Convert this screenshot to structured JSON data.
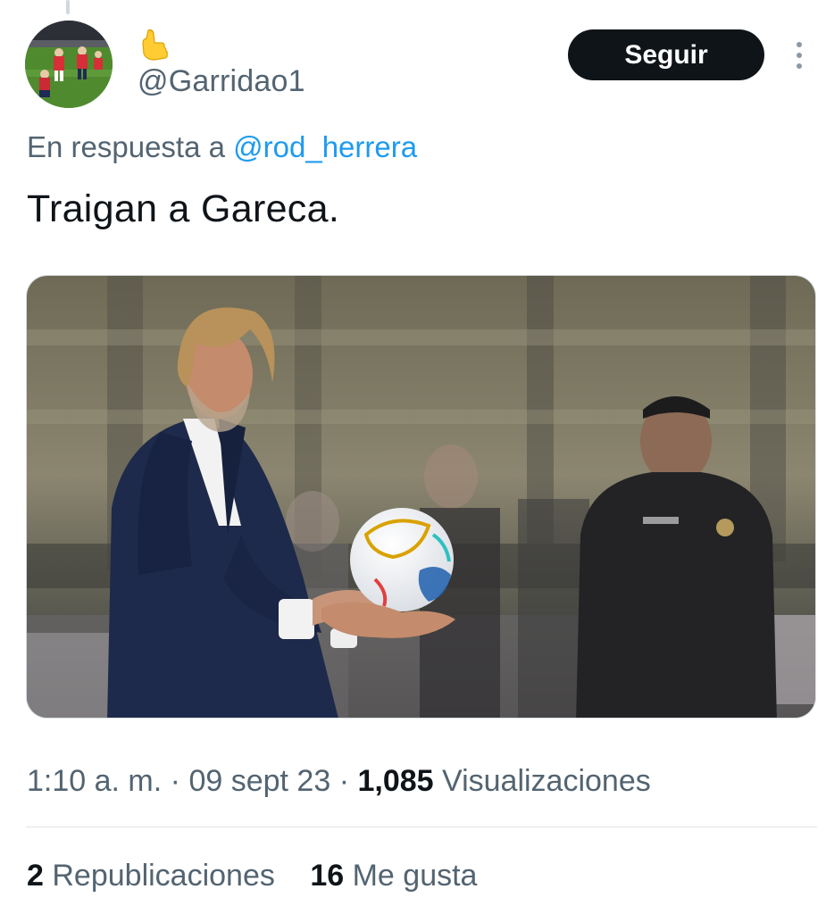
{
  "author": {
    "handle": "@Garridao1",
    "display_name_emoji": "call-me-hand-emoji"
  },
  "actions": {
    "follow_label": "Seguir",
    "more_icon": "more-vertical-icon"
  },
  "reply": {
    "prefix": "En respuesta a",
    "mention": "@rod_herrera"
  },
  "tweet": {
    "text": "Traigan a Gareca."
  },
  "meta": {
    "time": "1:10 a. m.",
    "sep1": "·",
    "date": "09 sept 23",
    "sep2": "·",
    "views_count": "1,085",
    "views_label": "Visualizaciones"
  },
  "stats": {
    "reposts_count": "2",
    "reposts_label": "Republicaciones",
    "likes_count": "16",
    "likes_label": "Me gusta"
  },
  "colors": {
    "accent_link": "#1d9bf0",
    "text_primary": "#0f1419",
    "text_secondary": "#536471",
    "button_bg": "#0f1419"
  }
}
